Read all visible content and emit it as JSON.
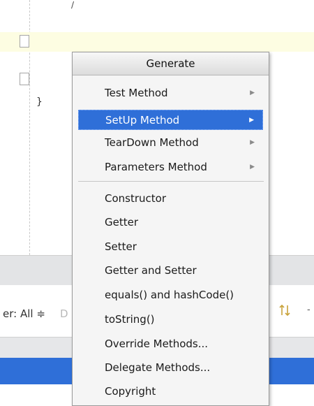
{
  "editor": {
    "closing_brace": "}",
    "stray_mark": "/"
  },
  "filter_bar": {
    "filter_label": "er: All ≑",
    "ghost_text": "D",
    "trailing_glyph": "-"
  },
  "menu": {
    "title": "Generate",
    "submenu_items": [
      {
        "label": "Test Method",
        "arrow": "▶"
      },
      {
        "label": "SetUp Method",
        "arrow": "▶"
      },
      {
        "label": "TearDown Method",
        "arrow": "▶"
      },
      {
        "label": "Parameters Method",
        "arrow": "▶"
      }
    ],
    "items": [
      {
        "label": "Constructor"
      },
      {
        "label": "Getter"
      },
      {
        "label": "Setter"
      },
      {
        "label": "Getter and Setter"
      },
      {
        "label": "equals() and hashCode()"
      },
      {
        "label": "toString()"
      },
      {
        "label": "Override Methods..."
      },
      {
        "label": "Delegate Methods..."
      },
      {
        "label": "Copyright"
      }
    ],
    "selected_item": "SetUp Method"
  },
  "colors": {
    "selection": "#2f6fd8",
    "highlight_row": "#fdfde2",
    "menu_background": "#f5f5f5"
  },
  "icons": {
    "submenu_arrow": "submenu-arrow-icon",
    "sort": "sort-icon"
  }
}
